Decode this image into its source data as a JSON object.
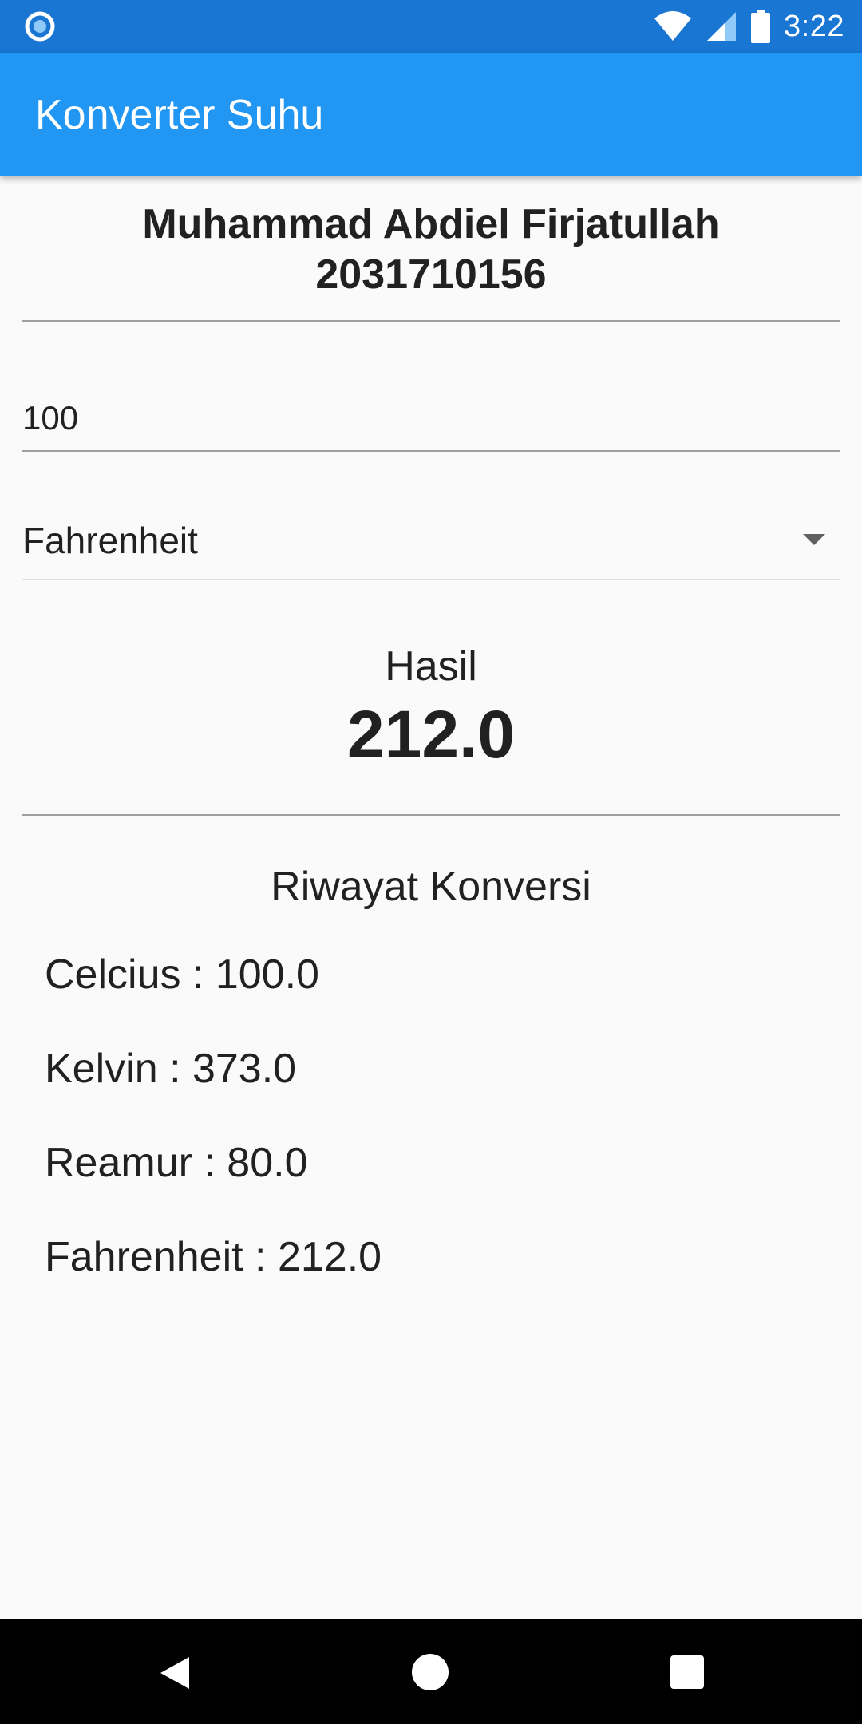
{
  "status_bar": {
    "time": "3:22",
    "left_icon": "notification-circle-icon",
    "wifi_icon": "wifi-icon",
    "signal_icon": "signal-icon",
    "battery_icon": "battery-icon",
    "color": "#1976d2"
  },
  "app_bar": {
    "title": "Konverter Suhu",
    "color": "#2196f3"
  },
  "student": {
    "name": "Muhammad Abdiel Firjatullah",
    "id": "2031710156"
  },
  "input": {
    "value": "100"
  },
  "dropdown": {
    "selected": "Fahrenheit",
    "arrow_icon": "dropdown-arrow-icon"
  },
  "result": {
    "label": "Hasil",
    "value": "212.0"
  },
  "history": {
    "title": "Riwayat Konversi",
    "items": [
      "Celcius : 100.0",
      "Kelvin : 373.0",
      "Reamur : 80.0",
      "Fahrenheit : 212.0"
    ]
  },
  "nav_bar": {
    "back_icon": "back-triangle-icon",
    "home_icon": "home-circle-icon",
    "recent_icon": "recent-apps-square-icon"
  }
}
